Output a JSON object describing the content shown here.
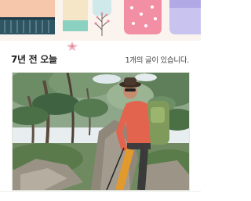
{
  "memories": {
    "title": "7년 전 오늘",
    "post_count_text": "1개의 글이 있습니다.",
    "photo_alt": "등산 사진"
  },
  "colors": {
    "banner_bg": "#fbf4ee",
    "title_text": "#222222",
    "count_text": "#444444"
  },
  "icons": {
    "branch": "branch-icon",
    "flower": "flower-icon"
  }
}
